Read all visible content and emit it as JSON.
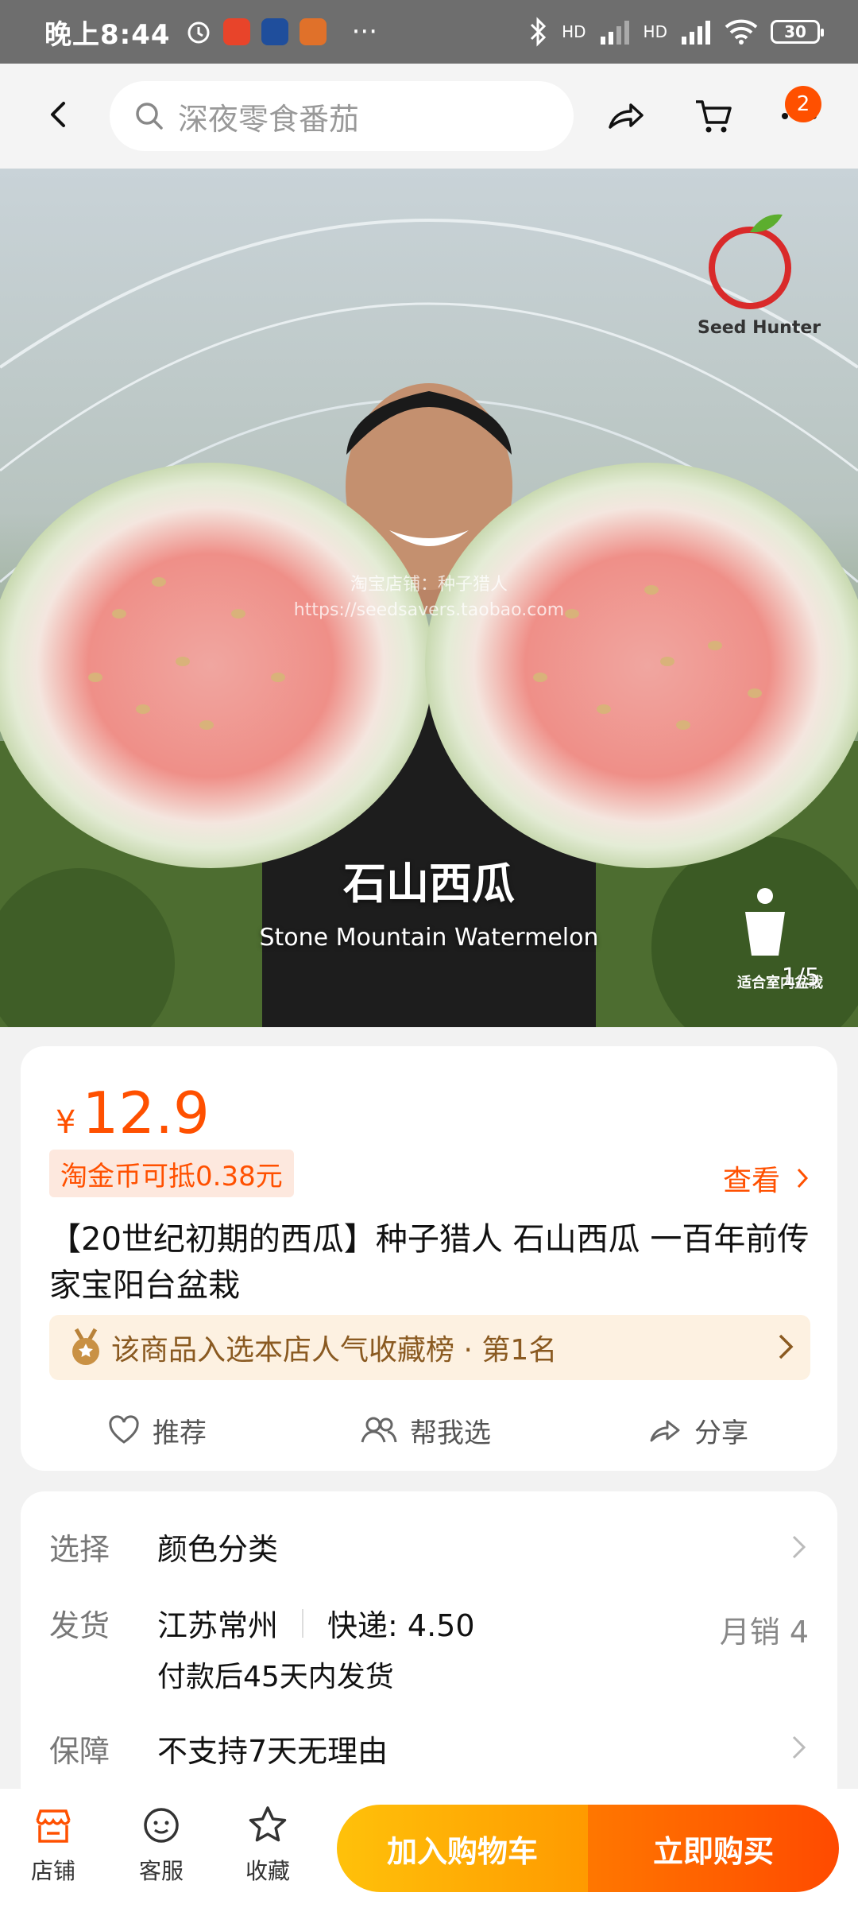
{
  "status_bar": {
    "time": "晚上8:44",
    "battery": "30",
    "network_1": "HD",
    "network_2": "HD",
    "overflow": "···"
  },
  "nav": {
    "search_placeholder": "深夜零食番茄",
    "cart_badge": "2"
  },
  "hero": {
    "caption_cn": "石山西瓜",
    "caption_en": "Stone Mountain Watermelon",
    "counter": "1/5",
    "brand": "Seed Hunter",
    "watermark_line1": "淘宝店铺：种子猎人",
    "watermark_line2": "https://seedsavers.taobao.com",
    "pot_label": "适合室内盆栽"
  },
  "product": {
    "currency": "¥",
    "price": "12.9",
    "coin_offer": "淘金币可抵0.38元",
    "view_label": "查看",
    "title": "【20世纪初期的西瓜】种子猎人 石山西瓜 一百年前传家宝阳台盆栽",
    "rank_text": "该商品入选本店人气收藏榜 · 第1名",
    "actions": {
      "recommend": "推荐",
      "help_choose": "帮我选",
      "share": "分享"
    }
  },
  "specs": {
    "select_label": "选择",
    "select_value": "颜色分类",
    "ship_label": "发货",
    "ship_origin": "江苏常州",
    "ship_fee": "快递: 4.50",
    "monthly_sales": "月销  4",
    "ship_time": "付款后45天内发货",
    "guarantee_label": "保障",
    "guarantee_value": "不支持7天无理由"
  },
  "bottom_bar": {
    "store": "店铺",
    "service": "客服",
    "favorite": "收藏",
    "add_cart": "加入购物车",
    "buy_now": "立即购买"
  },
  "colors": {
    "accent": "#ff5000",
    "cart_button": "#ffa500",
    "buy_button": "#ff5000"
  }
}
